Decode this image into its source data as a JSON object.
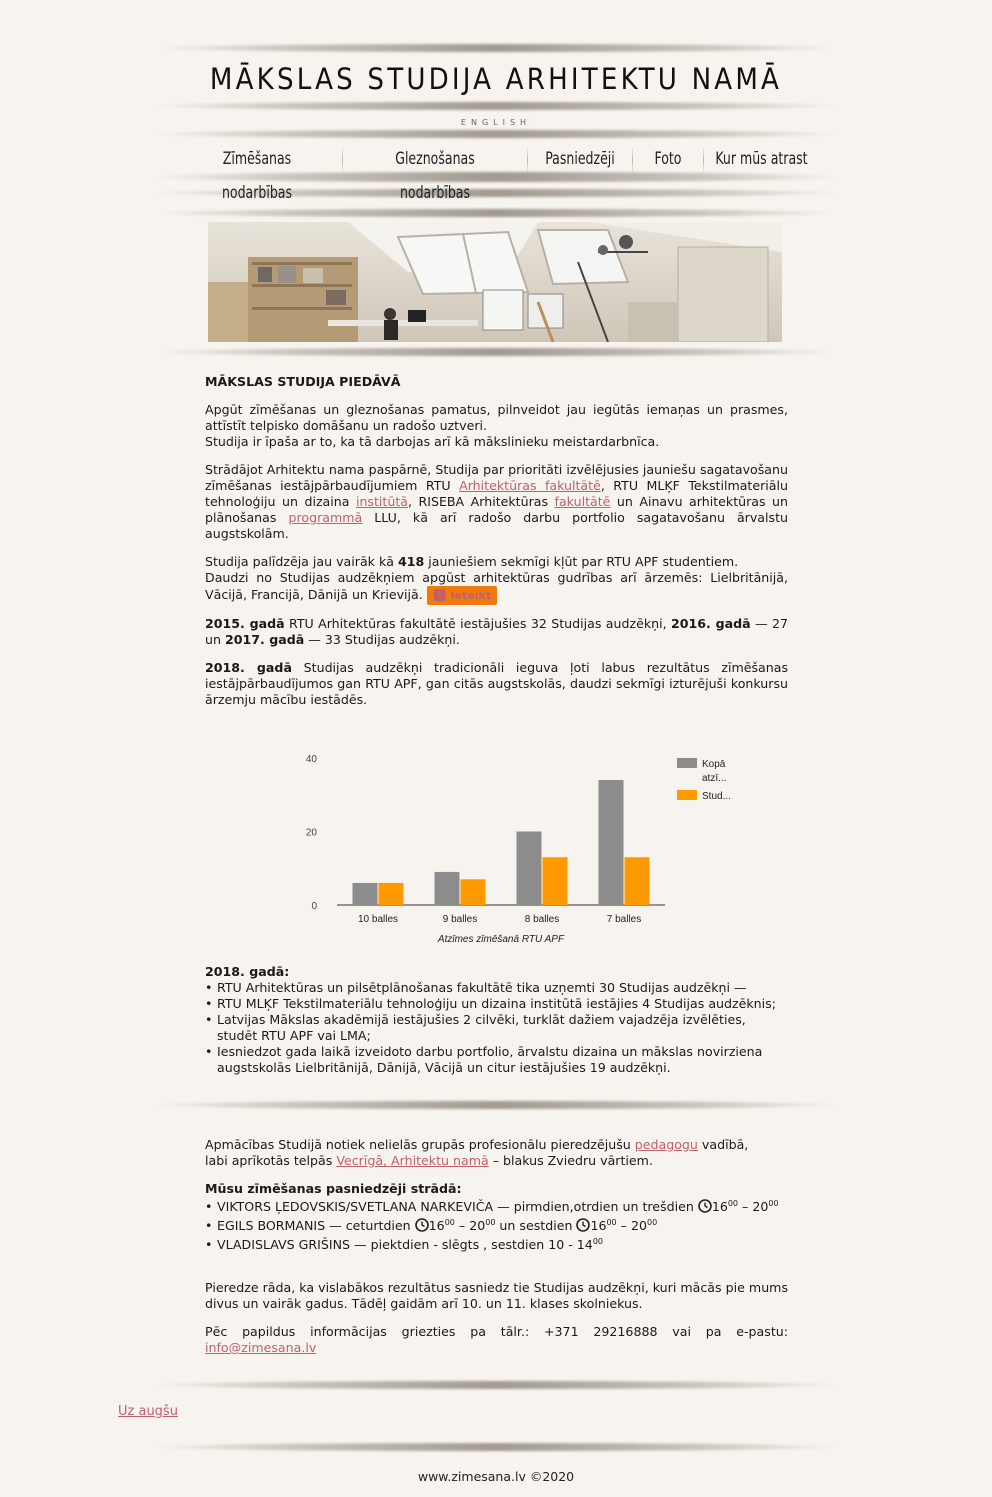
{
  "header": {
    "site_title": "MĀKSLAS STUDIJA ARHITEKTU NAMĀ",
    "lang_link": "ENGLISH"
  },
  "nav": {
    "items": [
      {
        "label": "Zīmēšanas nodarbības"
      },
      {
        "label": "Gleznošanas nodarbības"
      },
      {
        "label": "Pasniedzēji"
      },
      {
        "label": "Foto"
      },
      {
        "label": "Kur mūs atrast"
      }
    ]
  },
  "intro": {
    "heading": "MĀKSLAS STUDIJA PIEDĀVĀ",
    "p1_line1": "Apgūt zīmēšanas un gleznošanas pamatus, pilnveidot jau iegūtās iemaņas un prasmes, attīstīt telpisko domāšanu un radošo uztveri.",
    "p1_line2": "Studija ir īpaša ar to, ka tā darbojas arī kā mākslinieku meistardarbnīca.",
    "p2_a": "Strādājot Arhitektu nama paspārnē, Studija par prioritāti izvēlējusies jauniešu sagatavošanu zīmēšanas iestājpārbaudījumiem RTU ",
    "p2_link1": "Arhitektūras fakultātē",
    "p2_b": ", RTU MLĶF Tekstilmateriālu tehnoloģiju un dizaina ",
    "p2_link2": "institūtā",
    "p2_c": ", RISEBA Arhitektūras ",
    "p2_link3": "fakultātē",
    "p2_d": " un Ainavu arhitektūras un plānošanas ",
    "p2_link4": "programmā",
    "p2_e": " LLU, kā arī radošo darbu portfolio sagatavošanu ārvalstu augstskolām.",
    "p3_a": "Studija palīdzēja jau vairāk kā ",
    "p3_num": "418",
    "p3_b": " jauniešiem sekmīgi kļūt par RTU APF studentiem.",
    "p3_c": "Daudzi no Studijas audzēkņiem apgūst arhitektūras gudrības arī ārzemēs: Lielbritānijā, Vācijā, Francijā, Dānijā un Krievijā.",
    "recommend_button": "Ieteikt",
    "p4_y1": "2015. gadā",
    "p4_a": " RTU Arhitektūras fakultātē iestājušies 32 Studijas audzēkņi, ",
    "p4_y2": "2016. gadā",
    "p4_b": " — 27 un ",
    "p4_y3": "2017. gadā",
    "p4_c": " — 33 Studijas audzēkņi.",
    "p5_y": "2018. gadā",
    "p5_text": " Studijas audzēkņi tradicionāli ieguva ļoti labus rezultātus zīmēšanas iestājpārbaudījumos gan RTU APF, gan citās augstskolās, daudzi sekmīgi izturējuši konkursu ārzemju mācību iestādēs."
  },
  "chart_data": {
    "type": "bar",
    "categories": [
      "10 balles",
      "9 balles",
      "8 balles",
      "7 balles"
    ],
    "series": [
      {
        "name": "Kopā atzī...",
        "values": [
          6,
          9,
          20,
          34
        ],
        "color": "#8c8c8c"
      },
      {
        "name": "Stud...",
        "values": [
          6,
          7,
          13,
          13
        ],
        "color": "#ff9900"
      }
    ],
    "xlabel": "Atzīmes zīmēšanā RTU APF",
    "ylabel": "",
    "ylim": [
      0,
      40
    ],
    "yticks": [
      "0",
      "20",
      "40"
    ],
    "legend": "right",
    "grid": false
  },
  "results2018": {
    "heading": "2018. gadā:",
    "items": [
      "RTU Arhitektūras un pilsētplānošanas fakultātē tika uzņemti 30 Studijas audzēkņi —",
      "RTU MLĶF Tekstilmateriālu tehnoloģiju un dizaina institūtā iestājies 4 Studijas audzēknis;",
      "Latvijas Mākslas akadēmijā iestājušies 2 cilvēki, turklāt dažiem vajadzēja izvēlēties, studēt RTU APF vai LMA;",
      "Iesniedzot gada laikā izveidoto darbu portfolio, ārvalstu dizaina un mākslas novirziena augstskolās Lielbritānijā, Dānijā, Vācijā un citur iestājušies 19 audzēkņi."
    ]
  },
  "about": {
    "p1_a": "Apmācības Studijā notiek nelielās grupās profesionālu pieredzējušu ",
    "p1_link1": "pedagogu",
    "p1_b": " vadībā,",
    "p1_c": "labi aprīkotās telpās ",
    "p1_link2": "Vecrīgā, Arhitektu namā",
    "p1_d": " – blakus Zviedru vārtiem.",
    "teachers_heading": "Mūsu zīmēšanas pasniedzēji strādā:",
    "t1_a": "VIKTORS ĻEDOVSKIS/SVETLANA NARKEVIČA — pirmdien,otrdien un trešdien ",
    "t1_time": "16",
    "t1_sup1": "00",
    "t1_dash": " – 20",
    "t1_sup2": "00",
    "t2_a": "EGILS BORMANIS — ceturtdien ",
    "t2_time1": "16",
    "t2_sup1": "00",
    "t2_mid": " – 20",
    "t2_sup2": "00",
    "t2_b": " un sestdien ",
    "t2_time2": "16",
    "t2_sup3": "00",
    "t2_mid2": " – 20",
    "t2_sup4": "00",
    "t3_a": "VLADISLAVS GRIŠINS — piektdien - slēgts , sestdien 10 - 14",
    "t3_sup": "00",
    "p2": "Pieredze rāda, ka vislabākos rezultātus sasniedz tie Studijas audzēkņi, kuri mācās pie mums divus un vairāk gadus. Tādēļ gaidām arī 10. un 11. klases skolniekus.",
    "p3_a": "Pēc papildus informācijas griezties pa tālr.: +371 29216888 vai pa e-pastu: ",
    "p3_email": "info@zimesana.lv"
  },
  "to_top": "Uz augšu",
  "footer": "www.zimesana.lv ©2020",
  "colors": {
    "background": "#f7f4ef",
    "link": "#c0606a",
    "button_orange": "#f07a0c",
    "bar_gray": "#8c8c8c",
    "bar_orange": "#ff9900"
  }
}
